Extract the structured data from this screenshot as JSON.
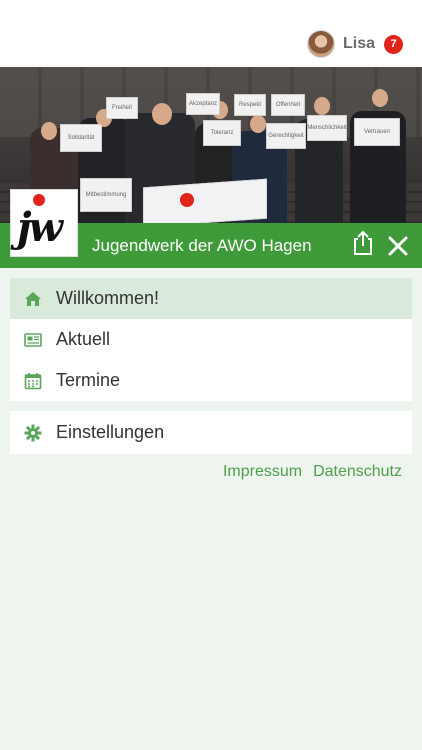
{
  "user": {
    "name": "Lisa",
    "notifications": "7"
  },
  "header": {
    "org_name": "Jugendwerk der AWO Hagen",
    "logo_text": "jw"
  },
  "hero": {
    "signs": [
      "Akzeptanz",
      "Toleranz",
      "Offenheit",
      "Vertrauen",
      "Respekt",
      "Solidarität",
      "Gerechtigkeit",
      "Menschlichkeit",
      "Mitbestimmung",
      "Freiheit"
    ]
  },
  "menu": {
    "primary": [
      {
        "label": "Willkommen!",
        "icon": "home-icon",
        "active": true
      },
      {
        "label": "Aktuell",
        "icon": "newspaper-icon",
        "active": false
      },
      {
        "label": "Termine",
        "icon": "calendar-icon",
        "active": false
      }
    ],
    "secondary": [
      {
        "label": "Einstellungen",
        "icon": "gear-icon",
        "active": false
      }
    ]
  },
  "links": {
    "impressum": "Impressum",
    "datenschutz": "Datenschutz"
  },
  "colors": {
    "brand_green": "#3f9a3a",
    "accent_red": "#e2231a",
    "active_bg": "#d9eadb",
    "page_bg": "#eef4ee",
    "link_green": "#4fa04a"
  }
}
